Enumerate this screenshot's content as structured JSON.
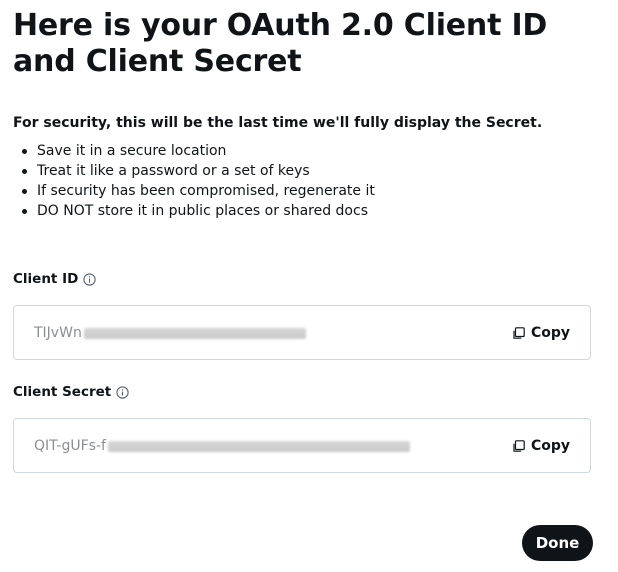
{
  "dialog": {
    "title": "Here is your OAuth 2.0 Client ID and Client Secret",
    "security_notice": "For security, this will be the last time we'll fully display the Secret.",
    "bullets": [
      "Save it in a secure location",
      "Treat it like a password or a set of keys",
      "If security has been compromised, regenerate it",
      "DO NOT store it in public places or shared docs"
    ],
    "client_id": {
      "label": "Client ID",
      "info_icon": "info-icon",
      "value_visible": "TIJvWn",
      "copy_label": "Copy",
      "copy_icon": "copy-icon"
    },
    "client_secret": {
      "label": "Client Secret",
      "info_icon": "info-icon",
      "value_visible": "QIT-gUFs-f",
      "copy_label": "Copy",
      "copy_icon": "copy-icon"
    },
    "done_label": "Done"
  },
  "colors": {
    "text": "#0f1419",
    "muted_value": "#8a8f94",
    "border": "#cfd9de",
    "button_bg": "#0f1419",
    "button_text": "#ffffff"
  }
}
